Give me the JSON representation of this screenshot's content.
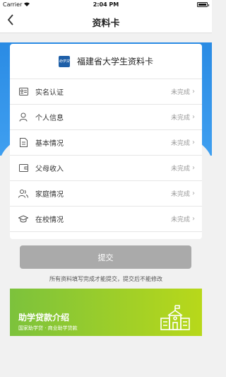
{
  "status_bar": {
    "carrier": "Carrier",
    "time": "2:04 PM"
  },
  "nav": {
    "back_icon": "chevron-left-icon",
    "title": "资料卡"
  },
  "card": {
    "logo_text": "助学贷",
    "title": "福建省大学生资料卡",
    "items": [
      {
        "icon": "id-card-icon",
        "label": "实名认证",
        "status": "未完成"
      },
      {
        "icon": "person-icon",
        "label": "个人信息",
        "status": "未完成"
      },
      {
        "icon": "document-icon",
        "label": "基本情况",
        "status": "未完成"
      },
      {
        "icon": "wallet-icon",
        "label": "父母收入",
        "status": "未完成"
      },
      {
        "icon": "family-icon",
        "label": "家庭情况",
        "status": "未完成"
      },
      {
        "icon": "graduation-cap-icon",
        "label": "在校情况",
        "status": "未完成"
      }
    ]
  },
  "submit_label": "提交",
  "note": "所有资料填写完成才能提交，提交后不能修改",
  "banner": {
    "title": "助学贷款介绍",
    "subtitle": "国家助学贷 · 商业助学贷款",
    "icon": "school-building-icon"
  },
  "colors": {
    "header_blue": "#2a8be4",
    "banner_green": "#7cc23c",
    "banner_yellow": "#b8d81a",
    "submit_disabled": "#aaaaaa"
  }
}
